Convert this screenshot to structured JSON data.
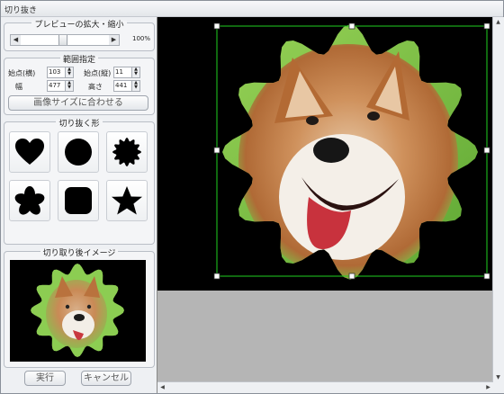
{
  "window": {
    "title": "切り抜き"
  },
  "preview_zoom": {
    "title": "プレビューの拡大・縮小",
    "percent": "100%",
    "level": 0.5
  },
  "range": {
    "title": "範囲指定",
    "start_x_label": "始点(横)",
    "start_x": "103",
    "start_y_label": "始点(縦)",
    "start_y": "11",
    "width_label": "幅",
    "width": "477",
    "height_label": "高さ",
    "height": "441",
    "fit_button": "画像サイズに合わせる"
  },
  "shapes": {
    "title": "切り抜く形",
    "items": [
      "heart-icon",
      "circle-icon",
      "badge-icon",
      "flower-icon",
      "rounded-square-icon",
      "star-icon"
    ]
  },
  "result": {
    "title": "切り取り後イメージ"
  },
  "actions": {
    "run": "実行",
    "cancel": "キャンセル"
  },
  "colors": {
    "selection": "#1fd11f",
    "background": "#000000"
  }
}
